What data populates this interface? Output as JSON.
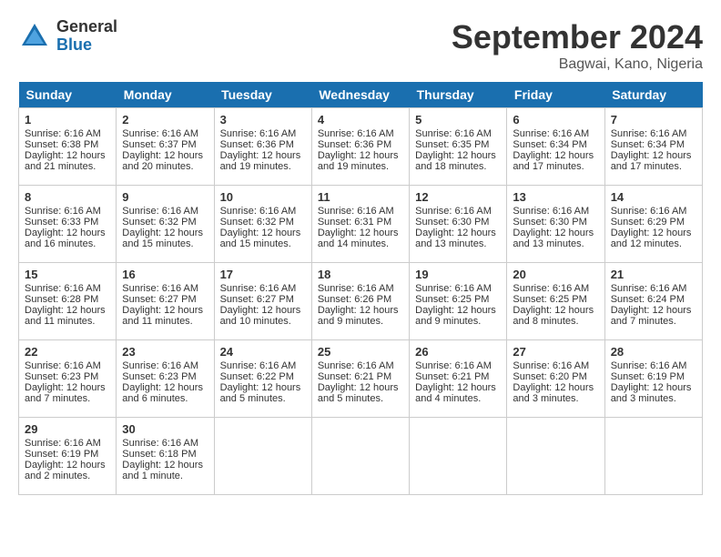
{
  "header": {
    "logo_general": "General",
    "logo_blue": "Blue",
    "title": "September 2024",
    "location": "Bagwai, Kano, Nigeria"
  },
  "days_of_week": [
    "Sunday",
    "Monday",
    "Tuesday",
    "Wednesday",
    "Thursday",
    "Friday",
    "Saturday"
  ],
  "weeks": [
    [
      {
        "day": "1",
        "sunrise": "Sunrise: 6:16 AM",
        "sunset": "Sunset: 6:38 PM",
        "daylight": "Daylight: 12 hours and 21 minutes."
      },
      {
        "day": "2",
        "sunrise": "Sunrise: 6:16 AM",
        "sunset": "Sunset: 6:37 PM",
        "daylight": "Daylight: 12 hours and 20 minutes."
      },
      {
        "day": "3",
        "sunrise": "Sunrise: 6:16 AM",
        "sunset": "Sunset: 6:36 PM",
        "daylight": "Daylight: 12 hours and 19 minutes."
      },
      {
        "day": "4",
        "sunrise": "Sunrise: 6:16 AM",
        "sunset": "Sunset: 6:36 PM",
        "daylight": "Daylight: 12 hours and 19 minutes."
      },
      {
        "day": "5",
        "sunrise": "Sunrise: 6:16 AM",
        "sunset": "Sunset: 6:35 PM",
        "daylight": "Daylight: 12 hours and 18 minutes."
      },
      {
        "day": "6",
        "sunrise": "Sunrise: 6:16 AM",
        "sunset": "Sunset: 6:34 PM",
        "daylight": "Daylight: 12 hours and 17 minutes."
      },
      {
        "day": "7",
        "sunrise": "Sunrise: 6:16 AM",
        "sunset": "Sunset: 6:34 PM",
        "daylight": "Daylight: 12 hours and 17 minutes."
      }
    ],
    [
      {
        "day": "8",
        "sunrise": "Sunrise: 6:16 AM",
        "sunset": "Sunset: 6:33 PM",
        "daylight": "Daylight: 12 hours and 16 minutes."
      },
      {
        "day": "9",
        "sunrise": "Sunrise: 6:16 AM",
        "sunset": "Sunset: 6:32 PM",
        "daylight": "Daylight: 12 hours and 15 minutes."
      },
      {
        "day": "10",
        "sunrise": "Sunrise: 6:16 AM",
        "sunset": "Sunset: 6:32 PM",
        "daylight": "Daylight: 12 hours and 15 minutes."
      },
      {
        "day": "11",
        "sunrise": "Sunrise: 6:16 AM",
        "sunset": "Sunset: 6:31 PM",
        "daylight": "Daylight: 12 hours and 14 minutes."
      },
      {
        "day": "12",
        "sunrise": "Sunrise: 6:16 AM",
        "sunset": "Sunset: 6:30 PM",
        "daylight": "Daylight: 12 hours and 13 minutes."
      },
      {
        "day": "13",
        "sunrise": "Sunrise: 6:16 AM",
        "sunset": "Sunset: 6:30 PM",
        "daylight": "Daylight: 12 hours and 13 minutes."
      },
      {
        "day": "14",
        "sunrise": "Sunrise: 6:16 AM",
        "sunset": "Sunset: 6:29 PM",
        "daylight": "Daylight: 12 hours and 12 minutes."
      }
    ],
    [
      {
        "day": "15",
        "sunrise": "Sunrise: 6:16 AM",
        "sunset": "Sunset: 6:28 PM",
        "daylight": "Daylight: 12 hours and 11 minutes."
      },
      {
        "day": "16",
        "sunrise": "Sunrise: 6:16 AM",
        "sunset": "Sunset: 6:27 PM",
        "daylight": "Daylight: 12 hours and 11 minutes."
      },
      {
        "day": "17",
        "sunrise": "Sunrise: 6:16 AM",
        "sunset": "Sunset: 6:27 PM",
        "daylight": "Daylight: 12 hours and 10 minutes."
      },
      {
        "day": "18",
        "sunrise": "Sunrise: 6:16 AM",
        "sunset": "Sunset: 6:26 PM",
        "daylight": "Daylight: 12 hours and 9 minutes."
      },
      {
        "day": "19",
        "sunrise": "Sunrise: 6:16 AM",
        "sunset": "Sunset: 6:25 PM",
        "daylight": "Daylight: 12 hours and 9 minutes."
      },
      {
        "day": "20",
        "sunrise": "Sunrise: 6:16 AM",
        "sunset": "Sunset: 6:25 PM",
        "daylight": "Daylight: 12 hours and 8 minutes."
      },
      {
        "day": "21",
        "sunrise": "Sunrise: 6:16 AM",
        "sunset": "Sunset: 6:24 PM",
        "daylight": "Daylight: 12 hours and 7 minutes."
      }
    ],
    [
      {
        "day": "22",
        "sunrise": "Sunrise: 6:16 AM",
        "sunset": "Sunset: 6:23 PM",
        "daylight": "Daylight: 12 hours and 7 minutes."
      },
      {
        "day": "23",
        "sunrise": "Sunrise: 6:16 AM",
        "sunset": "Sunset: 6:23 PM",
        "daylight": "Daylight: 12 hours and 6 minutes."
      },
      {
        "day": "24",
        "sunrise": "Sunrise: 6:16 AM",
        "sunset": "Sunset: 6:22 PM",
        "daylight": "Daylight: 12 hours and 5 minutes."
      },
      {
        "day": "25",
        "sunrise": "Sunrise: 6:16 AM",
        "sunset": "Sunset: 6:21 PM",
        "daylight": "Daylight: 12 hours and 5 minutes."
      },
      {
        "day": "26",
        "sunrise": "Sunrise: 6:16 AM",
        "sunset": "Sunset: 6:21 PM",
        "daylight": "Daylight: 12 hours and 4 minutes."
      },
      {
        "day": "27",
        "sunrise": "Sunrise: 6:16 AM",
        "sunset": "Sunset: 6:20 PM",
        "daylight": "Daylight: 12 hours and 3 minutes."
      },
      {
        "day": "28",
        "sunrise": "Sunrise: 6:16 AM",
        "sunset": "Sunset: 6:19 PM",
        "daylight": "Daylight: 12 hours and 3 minutes."
      }
    ],
    [
      {
        "day": "29",
        "sunrise": "Sunrise: 6:16 AM",
        "sunset": "Sunset: 6:19 PM",
        "daylight": "Daylight: 12 hours and 2 minutes."
      },
      {
        "day": "30",
        "sunrise": "Sunrise: 6:16 AM",
        "sunset": "Sunset: 6:18 PM",
        "daylight": "Daylight: 12 hours and 1 minute."
      },
      null,
      null,
      null,
      null,
      null
    ]
  ]
}
